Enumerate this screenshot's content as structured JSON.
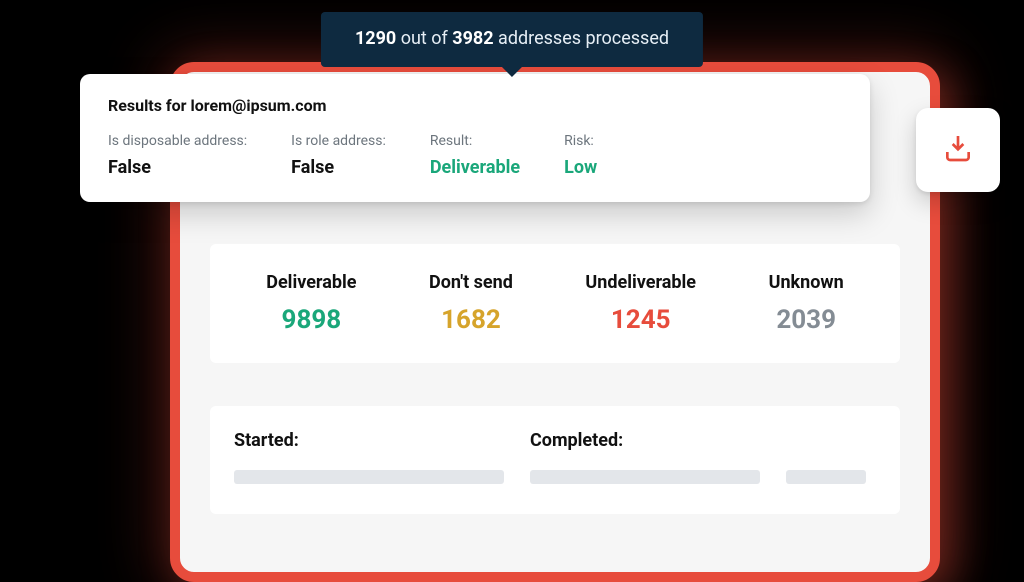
{
  "progress": {
    "done": "1290",
    "total": "3982",
    "prefix_text": "out of",
    "suffix_text": "addresses processed"
  },
  "results_card": {
    "title": "Results for lorem@ipsum.com",
    "items": [
      {
        "label": "Is disposable address:",
        "value": "False",
        "color": "black"
      },
      {
        "label": "Is role address:",
        "value": "False",
        "color": "black"
      },
      {
        "label": "Result:",
        "value": "Deliverable",
        "color": "green"
      },
      {
        "label": "Risk:",
        "value": "Low",
        "color": "green"
      }
    ]
  },
  "download_button": {
    "icon": "download-tray-icon"
  },
  "stats": [
    {
      "label": "Deliverable",
      "value": "9898",
      "color": "green"
    },
    {
      "label": "Don't send",
      "value": "1682",
      "color": "amber"
    },
    {
      "label": "Undeliverable",
      "value": "1245",
      "color": "red"
    },
    {
      "label": "Unknown",
      "value": "2039",
      "color": "gray"
    }
  ],
  "times": {
    "started_label": "Started:",
    "completed_label": "Completed:"
  }
}
